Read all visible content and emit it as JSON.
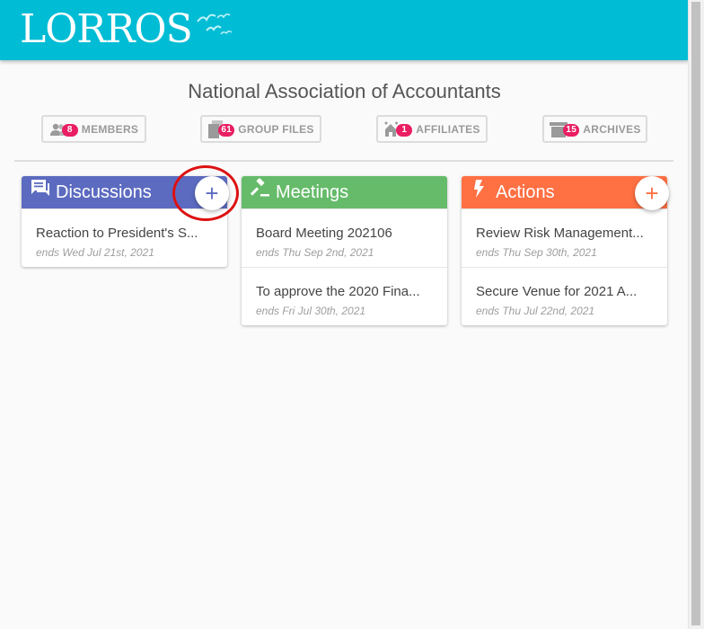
{
  "header": {
    "logo_text": "LORROS",
    "background": "#00bcd4"
  },
  "organization": {
    "title": "National Association of Accountants"
  },
  "nav": {
    "members": {
      "label": "MEMBERS",
      "count": "8",
      "icon": "people-icon"
    },
    "group_files": {
      "label": "GROUP FILES",
      "count": "61",
      "icon": "files-icon"
    },
    "affiliates": {
      "label": "AFFILIATES",
      "count": "1",
      "icon": "affiliates-icon"
    },
    "archives": {
      "label": "ARCHIVES",
      "count": "15",
      "icon": "archive-icon"
    }
  },
  "cards": {
    "discussions": {
      "title": "Discussions",
      "color": "#5c6bc0",
      "icon": "chat-icon",
      "add_label": "+",
      "items": [
        {
          "title": "Reaction to President's S...",
          "date": "ends Wed Jul 21st, 2021"
        }
      ]
    },
    "meetings": {
      "title": "Meetings",
      "color": "#66bb6a",
      "icon": "gavel-icon",
      "items": [
        {
          "title": "Board Meeting 202106",
          "date": "ends Thu Sep 2nd, 2021"
        },
        {
          "title": "To approve the 2020 Fina...",
          "date": "ends Fri Jul 30th, 2021"
        }
      ]
    },
    "actions": {
      "title": "Actions",
      "color": "#ff7043",
      "icon": "lightning-icon",
      "add_label": "+",
      "items": [
        {
          "title": "Review Risk Management...",
          "date": "ends Thu Sep 30th, 2021"
        },
        {
          "title": "Secure Venue for 2021 A...",
          "date": "ends Thu Jul 22nd, 2021"
        }
      ]
    }
  }
}
